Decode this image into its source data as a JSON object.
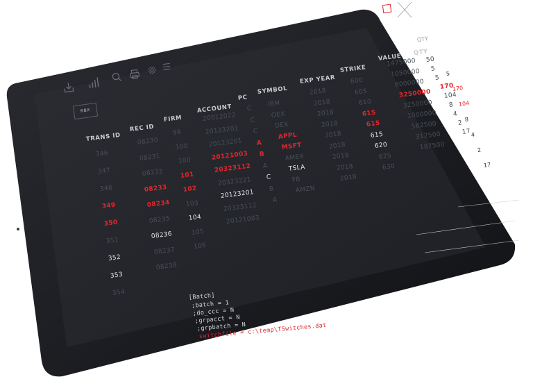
{
  "toolbar": {
    "icons": [
      "download-icon",
      "chart-icon",
      "search-icon",
      "print-icon",
      "gear-icon",
      "menu-icon"
    ]
  },
  "rbx_button_label": "RBX",
  "headers": {
    "trans_id": "TRANS ID",
    "rec_id": "REC ID",
    "firm": "FIRM",
    "account": "ACCOUNT",
    "pc": "PC",
    "symbol": "SYMBOL",
    "exp_year": "EXP YEAR",
    "strike": "STRIKE",
    "value": "VALUE",
    "qty": "QTY",
    "qty_ghost": "QTY"
  },
  "rows": [
    {
      "trans_id": "346",
      "rec_id": "08230",
      "firm": "99",
      "account": "20012022",
      "pc": "C",
      "symbol": "IBM",
      "exp_year": "2018",
      "strike": "600",
      "value": "1475000",
      "qty": "50"
    },
    {
      "trans_id": "347",
      "rec_id": "08231",
      "firm": "100",
      "account": "20123201",
      "pc": "C",
      "symbol": "OEX",
      "exp_year": "2018",
      "strike": "605",
      "value": "1050000",
      "qty": "5"
    },
    {
      "trans_id": "348",
      "rec_id": "08232",
      "firm": "100",
      "account": "20123201",
      "pc": "C",
      "symbol": "OEX",
      "exp_year": "2018",
      "strike": "610",
      "value": "6000000",
      "qty": "5"
    },
    {
      "trans_id": "349",
      "rec_id": "08233",
      "firm": "101",
      "account": "20121003",
      "pc": "A",
      "symbol": "APPL",
      "exp_year": "2018",
      "strike": "615",
      "value": "3250000",
      "qty": "170"
    },
    {
      "trans_id": "350",
      "rec_id": "08234",
      "firm": "102",
      "account": "20323112",
      "pc": "B",
      "symbol": "MSFT",
      "exp_year": "2018",
      "strike": "615",
      "value": "3250000",
      "qty": "104"
    },
    {
      "trans_id": "351",
      "rec_id": "08235",
      "firm": "103",
      "account": "20323221",
      "pc": "A",
      "symbol": "AMEX",
      "exp_year": "2018",
      "strike": "615",
      "value": "1000000",
      "qty": "8"
    },
    {
      "trans_id": "352",
      "rec_id": "08236",
      "firm": "104",
      "account": "20123201",
      "pc": "C",
      "symbol": "TSLA",
      "exp_year": "2018",
      "strike": "620",
      "value": "562500",
      "qty": "4"
    },
    {
      "trans_id": "353",
      "rec_id": "08237",
      "firm": "105",
      "account": "20323112",
      "pc": "B",
      "symbol": "FB",
      "exp_year": "2018",
      "strike": "625",
      "value": "312500",
      "qty": "2"
    },
    {
      "trans_id": "354",
      "rec_id": "08238",
      "firm": "106",
      "account": "20121003",
      "pc": "A",
      "symbol": "AMZN",
      "exp_year": "2018",
      "strike": "630",
      "value": "187500",
      "qty": "17"
    }
  ],
  "overflow_col_1": [
    "5",
    "170",
    "104",
    "8",
    "4",
    "2",
    "17"
  ],
  "overflow_col_2": [
    "50",
    "5",
    "5",
    "170",
    "104",
    "8",
    "4",
    "2",
    "17"
  ],
  "console": {
    "line1": "[Batch]",
    "line2": ";batch = 1",
    "line3": ";do_ccc = N",
    "line4": ";grpacct = N",
    "line5": ";grpbatch = N",
    "line6": "switchfile = c:\\temp\\TSwitches.dat"
  },
  "colors": {
    "accent_red": "#e3262b",
    "screen_bg": "#23252b",
    "bezel": "#15161a"
  }
}
